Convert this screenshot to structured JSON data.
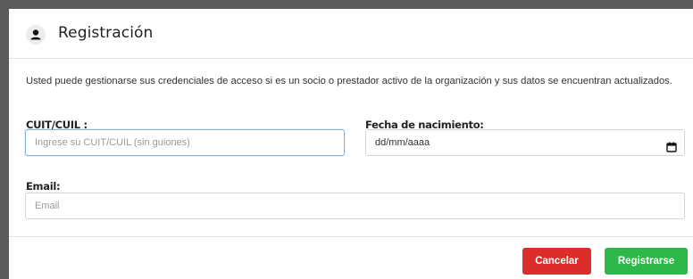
{
  "colors": {
    "frame": "#5b5b5b",
    "cancel_button": "#dc2d2d",
    "register_button": "#2eb84a",
    "focus_border": "#86b2d6"
  },
  "header": {
    "icon": "user-icon",
    "title": "Registración"
  },
  "body": {
    "intro": "Usted puede gestionarse sus credenciales de acceso si es un socio o prestador activo de la organización y sus datos se encuentran actualizados.",
    "cuit": {
      "label": "CUIT/CUIL :",
      "placeholder": "Ingrese su CUIT/CUIL (sin guiones)",
      "value": ""
    },
    "birth_date": {
      "label": "Fecha de nacimiento:",
      "value": "dd/mm/aaaa",
      "icon": "calendar-icon"
    },
    "email": {
      "label": "Email:",
      "placeholder": "Email",
      "value": ""
    }
  },
  "footer": {
    "cancel_label": "Cancelar",
    "register_label": "Registrarse"
  }
}
